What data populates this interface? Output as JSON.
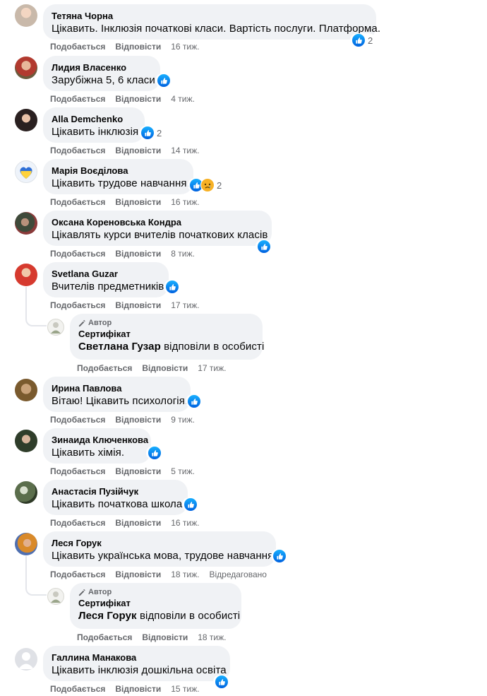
{
  "labels": {
    "like": "Подобається",
    "reply": "Відповісти",
    "edited": "Відредаговано",
    "author": "Автор"
  },
  "comments": [
    {
      "name": "Тетяна Чорна",
      "text": "Цікавить. Інклюзія початкові класи. Вартість послуги. Платформа.",
      "time": "16 тиж.",
      "reaction_count": "2"
    },
    {
      "name": "Лидия Власенко",
      "text": "Зарубіжна 5, 6 класи.",
      "time": "4 тиж."
    },
    {
      "name": "Alla Demchenko",
      "text": "Цікавить інклюзія",
      "time": "14 тиж.",
      "reaction_count": "2"
    },
    {
      "name": "Марія Воєділова",
      "text": "Цікавить трудове навчання.",
      "time": "16 тиж.",
      "reaction_count": "2"
    },
    {
      "name": "Оксана Кореновська Кондра",
      "text": "Цікавлять курси вчителів початкових класів",
      "time": "8 тиж."
    },
    {
      "name": "Svetlana Guzar",
      "text": "Вчителів предметників",
      "time": "17 тиж."
    },
    {
      "name": "Ирина Павлова",
      "text": "Вітаю! Цікавить психологія.",
      "time": "9 тиж."
    },
    {
      "name": "Зинаида Ключенкова",
      "text": "Цікавить хімія.",
      "time": "5 тиж."
    },
    {
      "name": "Анастасія Пузійчук",
      "text": "Цікавить початкова школа",
      "time": "16 тиж."
    },
    {
      "name": "Леся Горук",
      "text": "Цікавить українська мова, трудове навчання",
      "time": "18 тиж.",
      "edited": true
    },
    {
      "name": "Галлина Манакова",
      "text": "Цікавить інклюзія дошкільна освіта",
      "time": "15 тиж."
    }
  ],
  "replies": [
    {
      "name": "Сертифікат",
      "mention": "Светлана Гузар",
      "text": " відповіли в особисті",
      "time": "17 тиж."
    },
    {
      "name": "Сертифікат",
      "mention": "Леся Горук",
      "text": " відповіли в особисті",
      "time": "18 тиж."
    }
  ],
  "colors": {
    "bubble": "#f0f2f5",
    "meta": "#65676b",
    "like_blue": "#1877f2"
  }
}
